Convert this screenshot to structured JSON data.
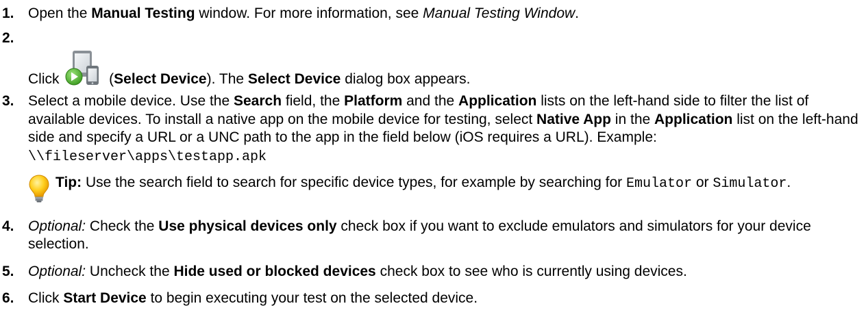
{
  "steps": [
    {
      "num": "1.",
      "t1": "Open the ",
      "b1": "Manual Testing",
      "t2": " window. For more information, see ",
      "i1": "Manual Testing Window",
      "t3": "."
    },
    {
      "num": "2.",
      "t1": "Click ",
      "icon": "select-device-icon",
      "t2": " (",
      "b1": "Select Device",
      "t3": "). The ",
      "b2": "Select Device",
      "t4": " dialog box appears."
    },
    {
      "num": "3.",
      "t1": "Select a mobile device. Use the ",
      "b1": "Search",
      "t2": " field, the ",
      "b2": "Platform",
      "t3": " and the ",
      "b3": "Application",
      "t4": " lists on the left-hand side to filter the list of available devices. To install a native app on the mobile device for testing, select ",
      "b4": "Native App",
      "t5": " in the ",
      "b5": "Application",
      "t6": " list on the left-hand side and specify a URL or a UNC path to the app in the field below (iOS requires a URL). Example: ",
      "code": "\\\\fileserver\\apps\\testapp.apk"
    },
    {
      "num": "4.",
      "i1": "Optional:",
      "t1": " Check the ",
      "b1": "Use physical devices only",
      "t2": " check box if you want to exclude emulators and simulators for your device selection."
    },
    {
      "num": "5.",
      "i1": "Optional:",
      "t1": " Uncheck the ",
      "b1": "Hide used or blocked devices",
      "t2": " check box to see who is currently using devices."
    },
    {
      "num": "6.",
      "t1": "Click ",
      "b1": "Start Device",
      "t2": " to begin executing your test on the selected device."
    }
  ],
  "tip": {
    "icon": "lightbulb-icon",
    "label": "Tip:",
    "t1": " Use the search field to search for specific device types, for example by searching for ",
    "code1": "Emulator",
    "t2": " or ",
    "code2": "Simulator",
    "t3": "."
  }
}
